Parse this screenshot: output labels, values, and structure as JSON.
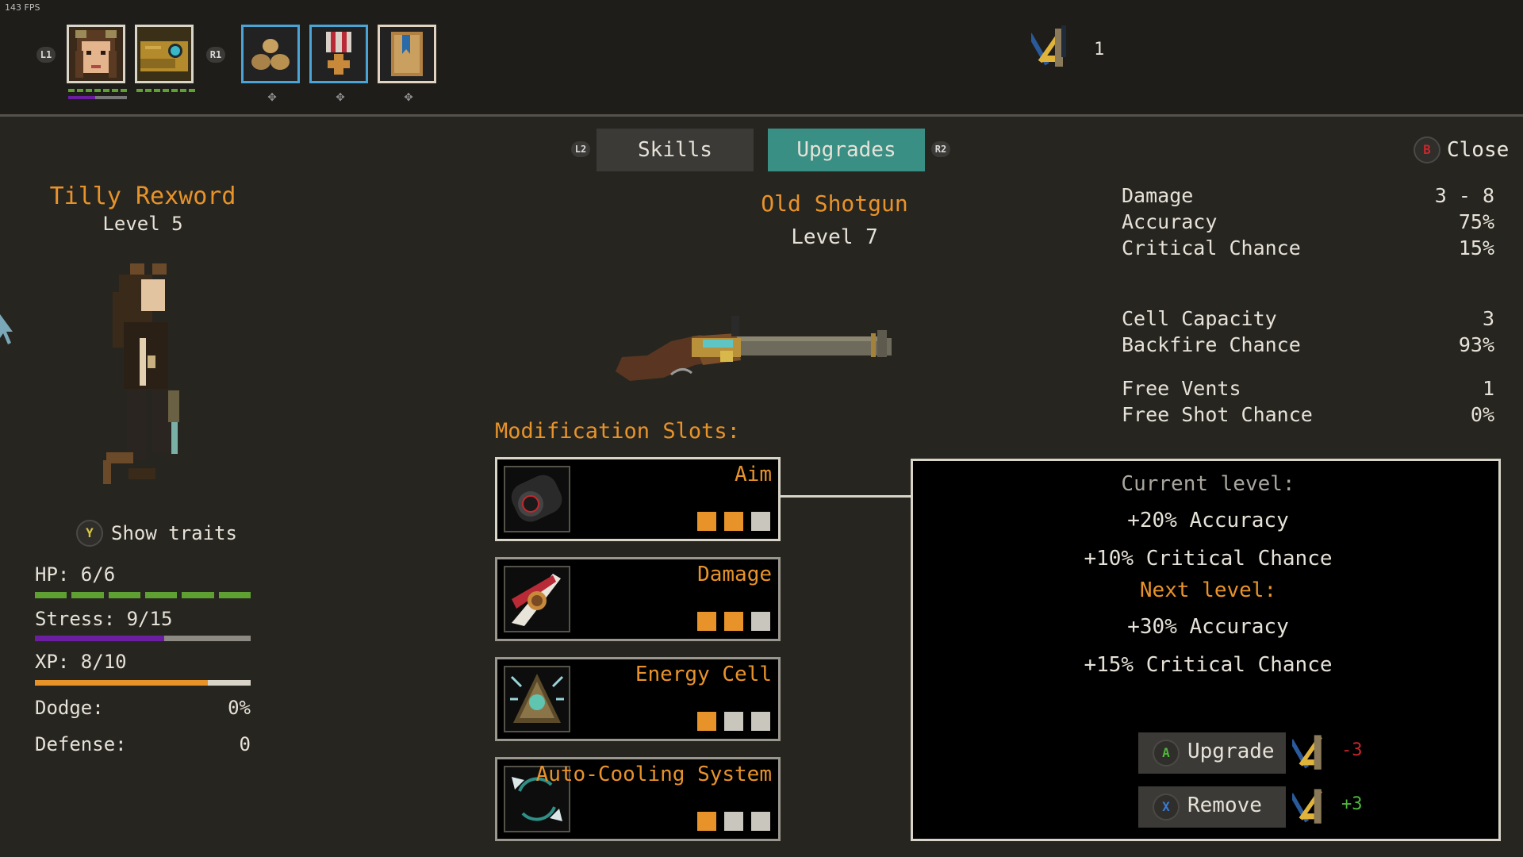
{
  "fps": "143 FPS",
  "top": {
    "l1": "L1",
    "r1": "R1",
    "scrap_count": "1"
  },
  "tabs": {
    "l2": "L2",
    "skills": "Skills",
    "upgrades": "Upgrades",
    "r2": "R2",
    "close_key": "B",
    "close": "Close"
  },
  "character": {
    "name": "Tilly Rexword",
    "level": "Level 5",
    "traits_key": "Y",
    "traits": "Show traits",
    "hp": "HP: 6/6",
    "hp_value": 6,
    "hp_max": 6,
    "stress": "Stress: 9/15",
    "stress_value": 9,
    "stress_max": 15,
    "xp": "XP: 8/10",
    "xp_value": 8,
    "xp_max": 10,
    "dodge_label": "Dodge:",
    "dodge": "0%",
    "defense_label": "Defense:",
    "defense": "0"
  },
  "weapon": {
    "name": "Old Shotgun",
    "level": "Level 7",
    "mod_heading": "Modification Slots:"
  },
  "stats": [
    {
      "label": "Damage",
      "value": "3 - 8"
    },
    {
      "label": "Accuracy",
      "value": "75%"
    },
    {
      "label": "Critical Chance",
      "value": "15%"
    },
    {
      "label": "Cell Capacity",
      "value": "3"
    },
    {
      "label": "Backfire Chance",
      "value": "93%"
    },
    {
      "label": "Free Vents",
      "value": "1"
    },
    {
      "label": "Free Shot Chance",
      "value": "0%"
    }
  ],
  "slots": [
    {
      "name": "Aim",
      "filled": 2,
      "total": 3
    },
    {
      "name": "Damage",
      "filled": 2,
      "total": 3
    },
    {
      "name": "Energy Cell",
      "filled": 1,
      "total": 3
    },
    {
      "name": "Auto-Cooling System",
      "filled": 1,
      "total": 3
    }
  ],
  "detail": {
    "current_heading": "Current level:",
    "current": [
      "+20% Accuracy",
      "+10% Critical Chance"
    ],
    "next_heading": "Next level:",
    "next": [
      "+30% Accuracy",
      "+15% Critical Chance"
    ],
    "upgrade_key": "A",
    "upgrade": "Upgrade",
    "upgrade_cost": "-3",
    "remove_key": "X",
    "remove": "Remove",
    "remove_refund": "+3"
  },
  "colors": {
    "accent_orange": "#e8932a",
    "tab_active": "#3a8f84",
    "hp_green": "#5fa033",
    "stress_purple": "#6b1fa0",
    "cost_red": "#c8262b",
    "refund_green": "#4fb83c"
  }
}
